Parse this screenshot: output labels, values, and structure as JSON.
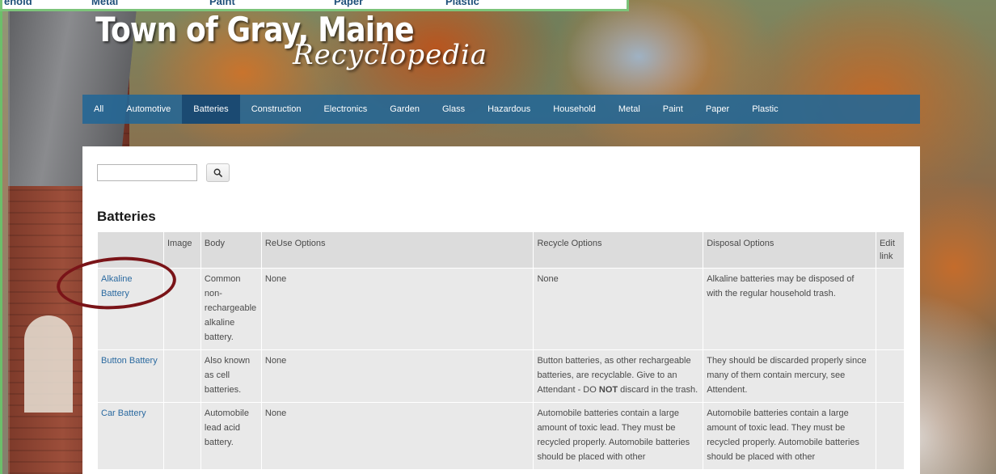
{
  "top_strip": {
    "cells": [
      "ehold",
      "Metal",
      "Paint",
      "Paper",
      "Plastic"
    ]
  },
  "header": {
    "title": "Town of Gray, Maine",
    "subtitle": "Recyclopedia"
  },
  "nav": {
    "items": [
      {
        "label": "All",
        "active": false
      },
      {
        "label": "Automotive",
        "active": false
      },
      {
        "label": "Batteries",
        "active": true
      },
      {
        "label": "Construction",
        "active": false
      },
      {
        "label": "Electronics",
        "active": false
      },
      {
        "label": "Garden",
        "active": false
      },
      {
        "label": "Glass",
        "active": false
      },
      {
        "label": "Hazardous",
        "active": false
      },
      {
        "label": "Household",
        "active": false
      },
      {
        "label": "Metal",
        "active": false
      },
      {
        "label": "Paint",
        "active": false
      },
      {
        "label": "Paper",
        "active": false
      },
      {
        "label": "Plastic",
        "active": false
      }
    ]
  },
  "search": {
    "value": "",
    "button_icon": "search-icon"
  },
  "page_title": "Batteries",
  "table": {
    "headers": [
      "",
      "Image",
      "Body",
      "ReUse Options",
      "Recycle Options",
      "Disposal Options",
      "Edit link"
    ],
    "rows": [
      {
        "name": "Alkaline Battery",
        "image": "",
        "body": "Common non-rechargeable alkaline battery.",
        "reuse": "None",
        "recycle": "None",
        "disposal": "Alkaline batteries may be disposed of with the regular household trash.",
        "edit": ""
      },
      {
        "name": "Button Battery",
        "image": "",
        "body": "Also known as cell batteries.",
        "reuse": "None",
        "recycle_pre": "Button batteries, as other rechargeable batteries, are recyclable. Give to an Attendant - DO ",
        "recycle_bold": "NOT",
        "recycle_post": " discard in the trash.",
        "disposal": "They should be discarded properly since many of them contain mercury, see Attendent.",
        "edit": ""
      },
      {
        "name": "Car Battery",
        "image": "",
        "body": "Automobile lead acid battery.",
        "reuse": "None",
        "recycle": "Automobile batteries contain a large amount of toxic lead. They must be recycled properly. Automobile batteries should be placed with other",
        "disposal": "Automobile batteries contain a large amount of toxic lead. They must be recycled properly. Automobile batteries should be placed with other",
        "edit": ""
      }
    ]
  },
  "colors": {
    "nav_bg": "#226796",
    "nav_active": "#1b4a72",
    "link": "#2b6aa0",
    "annotation": "#7a1418"
  }
}
